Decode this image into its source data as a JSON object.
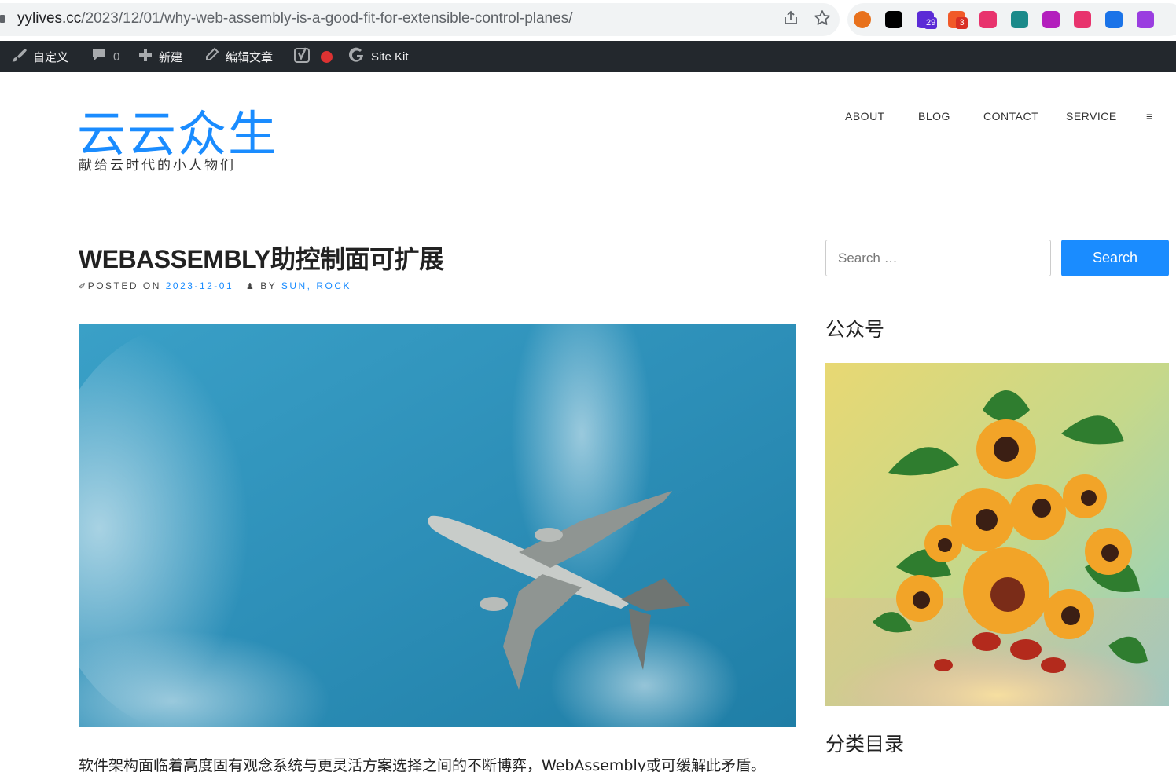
{
  "browser": {
    "url_host": "yylives.cc",
    "url_path": "/2023/12/01/why-web-assembly-is-a-good-fit-for-extensible-control-planes/",
    "share_icon": "share-icon",
    "bookmark_icon": "star-icon",
    "extensions": [
      {
        "name": "extension-orange-circle-icon",
        "color": "#e8711c"
      },
      {
        "name": "extension-notion-icon",
        "color": "#000000"
      },
      {
        "name": "extension-graduation-cap-icon",
        "color": "#5b2bd6",
        "badge": "29",
        "badge_color": "#5b2bd6"
      },
      {
        "name": "extension-tomato-icon",
        "color": "#f15a29",
        "badge": "3",
        "badge_color": "#d93025"
      },
      {
        "name": "extension-translate-icon",
        "color": "#e8336d"
      },
      {
        "name": "extension-grid-icon",
        "color": "#1b8a8a"
      },
      {
        "name": "extension-ublock-icon",
        "color": "#b31fbd"
      },
      {
        "name": "extension-crown-icon",
        "color": "#e8336d"
      },
      {
        "name": "extension-blue-bookmark-icon",
        "color": "#1a73e8"
      },
      {
        "name": "extension-openai-icon",
        "color": "#9a3de0"
      }
    ]
  },
  "adminbar": {
    "customize": "自定义",
    "comments_count": "0",
    "new": "新建",
    "edit_post": "编辑文章",
    "site_kit": "Site Kit"
  },
  "site": {
    "title": "云云众生",
    "description": "献给云时代的小人物们",
    "accent": "#1a8cff"
  },
  "nav": {
    "items": [
      "ABOUT",
      "BLOG",
      "CONTACT",
      "SERVICE"
    ],
    "menu_toggle": "≡"
  },
  "post": {
    "title": "WEBASSEMBLY助控制面可扩展",
    "posted_on_label": "POSTED ON",
    "date": "2023-12-01",
    "by_label": "BY",
    "author": "SUN, ROCK",
    "excerpt": "软件架构面临着高度固有观念系统与更灵活方案选择之间的不断博弈，WebAssembly或可缓解此矛盾。"
  },
  "sidebar": {
    "search_placeholder": "Search …",
    "search_button": "Search",
    "widget1_title": "公众号",
    "widget2_title": "分类目录"
  }
}
